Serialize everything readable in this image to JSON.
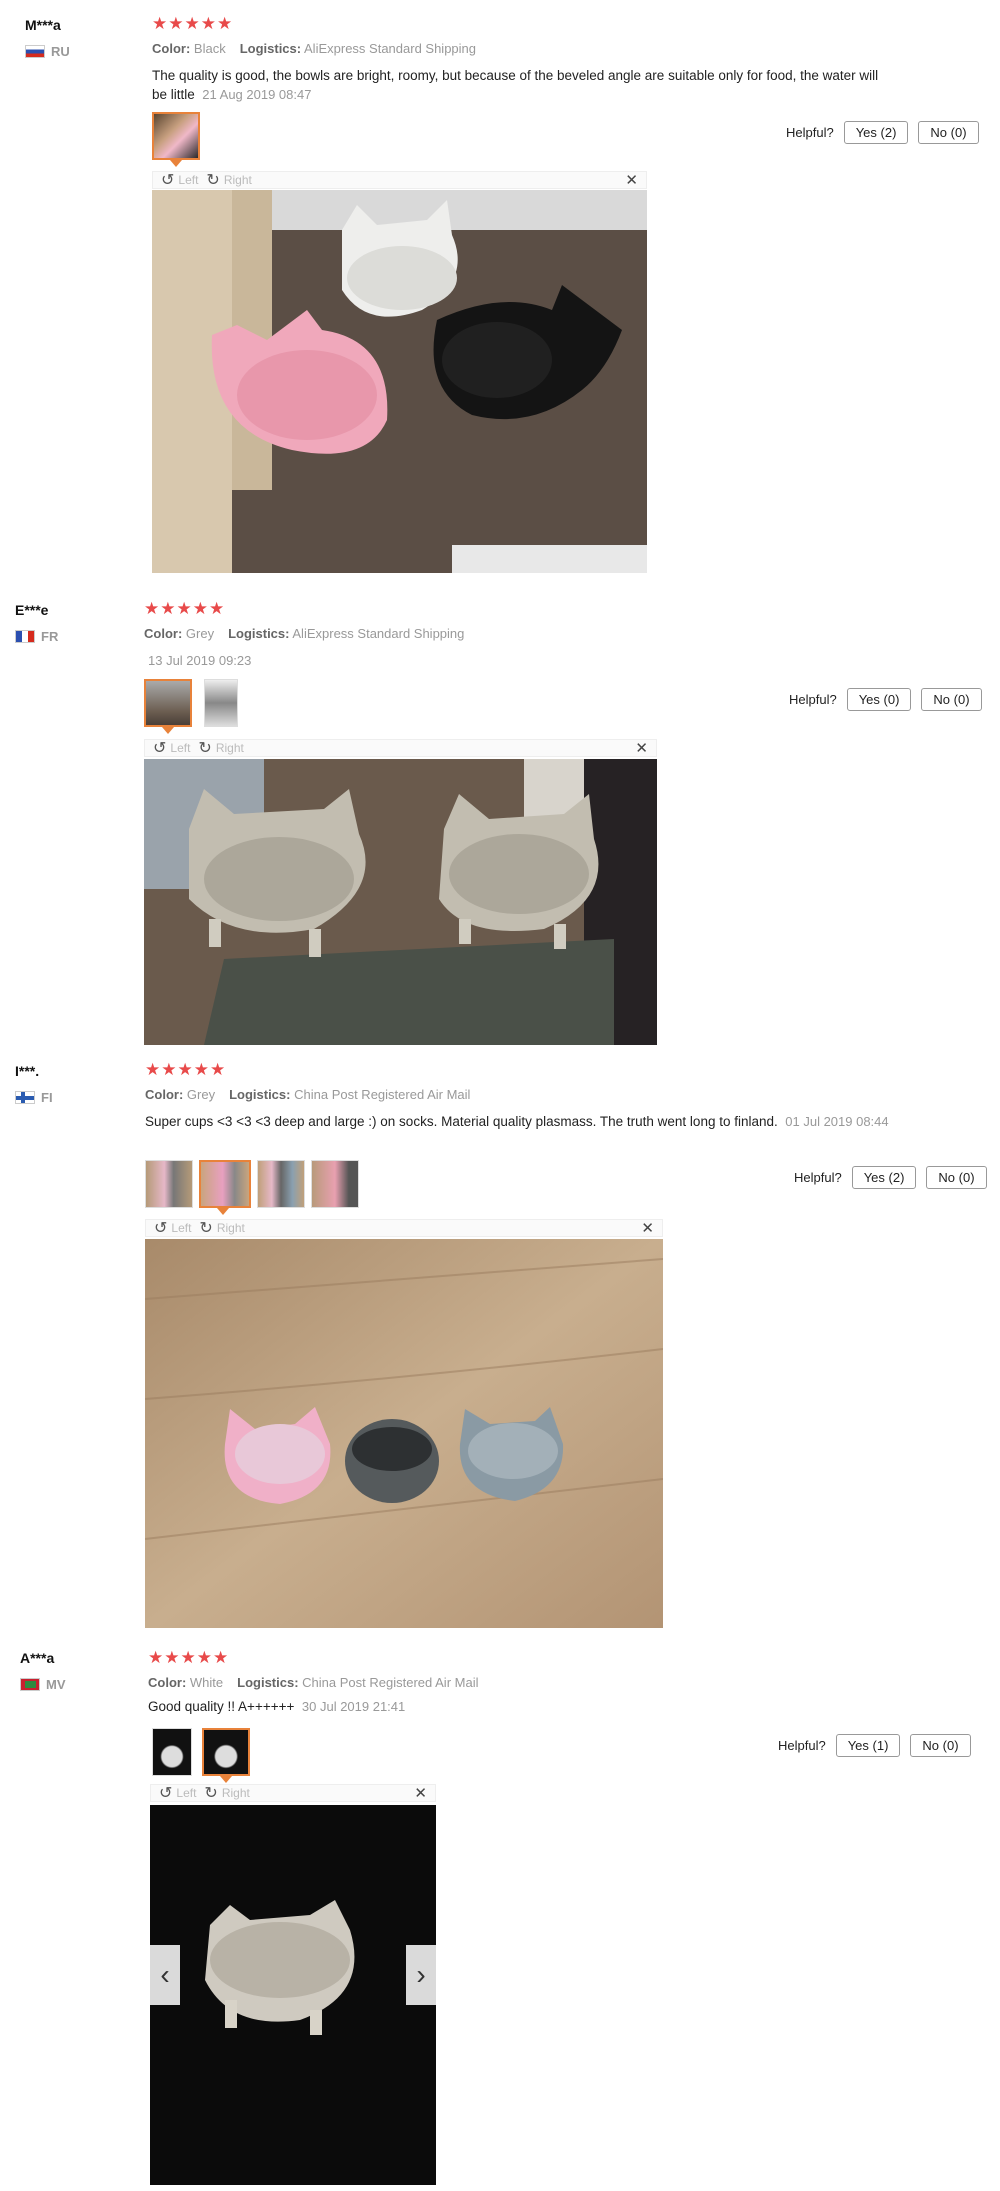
{
  "colors": {
    "star": "#e84a4a",
    "accent": "#e8823a",
    "muted": "#999999"
  },
  "labels": {
    "color": "Color:",
    "logistics": "Logistics:",
    "helpful": "Helpful?",
    "left": "Left",
    "right": "Right"
  },
  "reviews": [
    {
      "user": "M***a",
      "country": "RU",
      "stars": "★★★★★",
      "color": "Black",
      "logistics": "AliExpress Standard Shipping",
      "text": "The quality is good, the bowls are bright, roomy, but because of the beveled angle are suitable only for food, the water will be little",
      "date": "21 Aug 2019 08:47",
      "yes": "Yes (2)",
      "no": "No (0)"
    },
    {
      "user": "E***e",
      "country": "FR",
      "stars": "★★★★★",
      "color": "Grey",
      "logistics": "AliExpress Standard Shipping",
      "text": "",
      "date": "13 Jul 2019 09:23",
      "yes": "Yes (0)",
      "no": "No (0)"
    },
    {
      "user": "I***.",
      "country": "FI",
      "stars": "★★★★★",
      "color": "Grey",
      "logistics": "China Post Registered Air Mail",
      "text": "Super cups <3 <3 <3 deep and large :) on socks. Material quality plasmass. The truth went long to finland.",
      "date": "01 Jul 2019 08:44",
      "yes": "Yes (2)",
      "no": "No (0)"
    },
    {
      "user": "A***a",
      "country": "MV",
      "stars": "★★★★★",
      "color": "White",
      "logistics": "China Post Registered Air Mail",
      "text": "Good quality !! A++++++",
      "date": "30 Jul 2019 21:41",
      "yes": "Yes (1)",
      "no": "No (0)"
    }
  ]
}
